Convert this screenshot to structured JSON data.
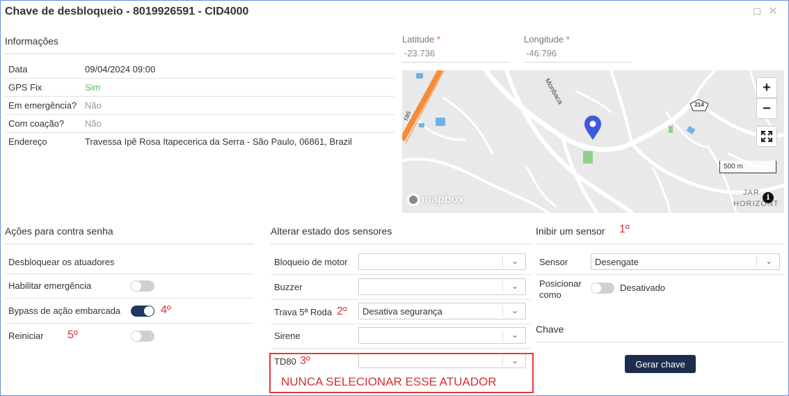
{
  "window": {
    "title": "Chave de desbloqueio - 8019926591 - CID4000",
    "maximize_icon": "square-icon",
    "close_glyph": "✕"
  },
  "info": {
    "title": "Informações",
    "rows": [
      {
        "label": "Data",
        "value": "09/04/2024 09:00"
      },
      {
        "label": "GPS Fix",
        "value": "Sim"
      },
      {
        "label": "Em emergência?",
        "value": "Não"
      },
      {
        "label": "Com coação?",
        "value": "Não"
      },
      {
        "label": "Endereço",
        "value": "Travessa Ipê Rosa Itapecerica da Serra - São Paulo, 06861, Brazil"
      }
    ]
  },
  "location": {
    "latitude_label": "Latitude",
    "latitude_value": "-23.736",
    "longitude_label": "Longitude",
    "longitude_value": "-46.796",
    "required_mark": "*"
  },
  "map": {
    "zoom_in": "+",
    "zoom_out": "−",
    "scale": "500 m",
    "logo": "mapbox",
    "road_label_1": "Monbaca",
    "road_label_2": "ras",
    "road_shield": "214",
    "area_label_1": "JAR",
    "area_label_2": "HORIZONT",
    "info_glyph": "i",
    "colors": {
      "background": "#e9e9e9",
      "road": "#ffffff",
      "highway": "#f28c3a",
      "water": "#6fb3e6",
      "park": "#8fd18a",
      "pin": "#3b5bdb"
    }
  },
  "actions": {
    "title": "Ações para contra senha",
    "items": [
      {
        "label": "Desbloquear os atuadores"
      },
      {
        "label": "Habilitar emergência"
      },
      {
        "label": "Bypass de ação embarcada"
      },
      {
        "label": "Reiniciar"
      }
    ]
  },
  "sensors_state": {
    "title": "Alterar estado dos sensores",
    "items": [
      {
        "label": "Bloqueio de motor",
        "value": ""
      },
      {
        "label": "Buzzer",
        "value": ""
      },
      {
        "label": "Trava 5ª Roda",
        "value": "Desativa segurança"
      },
      {
        "label": "Sirene",
        "value": ""
      },
      {
        "label": "TD80",
        "value": ""
      }
    ]
  },
  "inhibit": {
    "title": "Inibir um sensor",
    "sensor_label": "Sensor",
    "sensor_value": "Desengate",
    "position_label_1": "Posicionar",
    "position_label_2": "como",
    "position_value": "Desativado",
    "key_label": "Chave",
    "generate_button": "Gerar chave"
  },
  "annotations": {
    "a1": "1º",
    "a2": "2º",
    "a3": "3º",
    "a4": "4º",
    "a5": "5º",
    "note": "NUNCA SELECIONAR ESSE ATUADOR"
  },
  "toggles": {
    "habilitar_emergencia": false,
    "bypass": true,
    "reiniciar": false,
    "posicionar": false
  },
  "colors": {
    "accent": "#1f3864",
    "annotation": "#d32f2f",
    "success": "#5cb85c"
  }
}
